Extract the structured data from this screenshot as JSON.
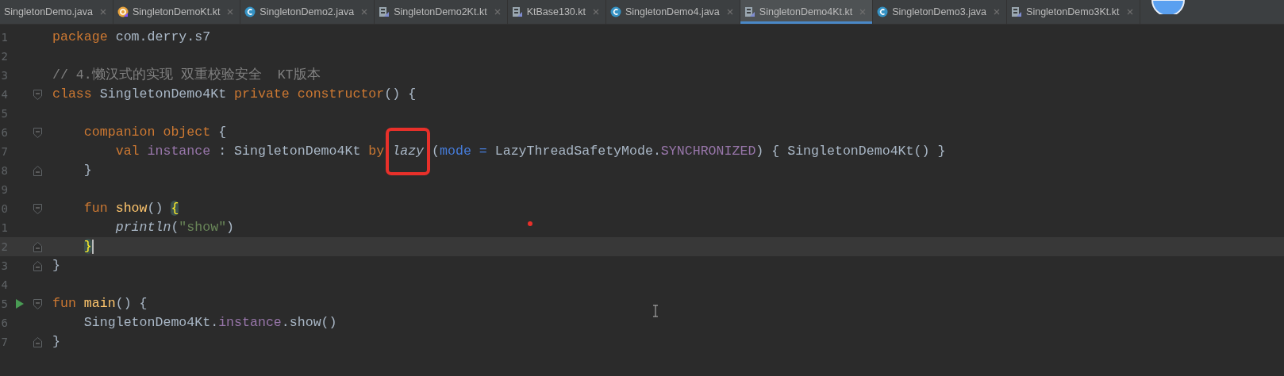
{
  "tabs": [
    {
      "label": "SingletonDemo.java",
      "kind": "plain",
      "selected": false
    },
    {
      "label": "SingletonDemoKt.kt",
      "kind": "kotlin-object",
      "selected": false
    },
    {
      "label": "SingletonDemo2.java",
      "kind": "java",
      "selected": false
    },
    {
      "label": "SingletonDemo2Kt.kt",
      "kind": "kotlin-file",
      "selected": false
    },
    {
      "label": "KtBase130.kt",
      "kind": "kotlin-file",
      "selected": false
    },
    {
      "label": "SingletonDemo4.java",
      "kind": "java",
      "selected": false
    },
    {
      "label": "SingletonDemo4Kt.kt",
      "kind": "kotlin-file",
      "selected": true
    },
    {
      "label": "SingletonDemo3.java",
      "kind": "java",
      "selected": false
    },
    {
      "label": "SingletonDemo3Kt.kt",
      "kind": "kotlin-file",
      "selected": false
    }
  ],
  "editor": {
    "lines": [
      {
        "number": "1",
        "kind": "plain",
        "current": false,
        "run": false,
        "tokens": [
          {
            "kind": "kw",
            "text": "package"
          },
          {
            "kind": "plain",
            "text": " com.derry.s7"
          }
        ]
      },
      {
        "number": "2",
        "kind": "plain",
        "current": false,
        "run": false
      },
      {
        "number": "3",
        "kind": "plain",
        "current": false,
        "run": false,
        "tokens": [
          {
            "kind": "comment",
            "text": "// 4.懒汉式的实现 双重校验安全  KT版本"
          }
        ]
      },
      {
        "number": "4",
        "kind": "fold-start",
        "current": false,
        "run": false,
        "tokens": [
          {
            "kind": "kw",
            "text": "class"
          },
          {
            "kind": "plain",
            "text": " SingletonDemo4Kt "
          },
          {
            "kind": "kw",
            "text": "private constructor"
          },
          {
            "kind": "plain",
            "text": "() {"
          }
        ]
      },
      {
        "number": "5",
        "kind": "plain",
        "current": false,
        "run": false
      },
      {
        "number": "6",
        "kind": "fold-start",
        "current": false,
        "run": false,
        "tokens": [
          {
            "kind": "kw",
            "text": "    companion object"
          },
          {
            "kind": "plain",
            "text": " {"
          }
        ]
      },
      {
        "number": "7",
        "kind": "plain",
        "current": false,
        "run": false,
        "tokens": [
          {
            "kind": "kw",
            "text": "        val "
          },
          {
            "kind": "prop",
            "text": "instance"
          },
          {
            "kind": "plain",
            "text": " : SingletonDemo4Kt "
          },
          {
            "kind": "kw",
            "text": "by "
          },
          {
            "kind": "call",
            "text": "lazy",
            "boxed": true
          },
          {
            "kind": "plain",
            "text": " ("
          },
          {
            "kind": "arg",
            "text": "mode = "
          },
          {
            "kind": "plain",
            "text": "LazyThreadSafetyMode."
          },
          {
            "kind": "prop",
            "text": "SYNCHRONIZED"
          },
          {
            "kind": "plain",
            "text": ") { SingletonDemo4Kt() }"
          }
        ]
      },
      {
        "number": "8",
        "kind": "fold-end",
        "current": false,
        "run": false,
        "tokens": [
          {
            "kind": "plain",
            "text": "    }"
          }
        ]
      },
      {
        "number": "9",
        "kind": "plain",
        "current": false,
        "run": false
      },
      {
        "number": "0",
        "kind": "fold-start",
        "current": false,
        "run": false,
        "tokens": [
          {
            "kind": "kw",
            "text": "    fun "
          },
          {
            "kind": "decl",
            "text": "show"
          },
          {
            "kind": "plain",
            "text": "() "
          },
          {
            "kind": "brace",
            "text": "{"
          }
        ]
      },
      {
        "number": "1",
        "kind": "plain",
        "current": false,
        "run": false,
        "tokens": [
          {
            "kind": "call",
            "text": "        println"
          },
          {
            "kind": "plain",
            "text": "("
          },
          {
            "kind": "str",
            "text": "\"show\""
          },
          {
            "kind": "plain",
            "text": ")"
          }
        ]
      },
      {
        "number": "2",
        "kind": "fold-end",
        "current": true,
        "run": false,
        "tokens": [
          {
            "kind": "brace",
            "text": "    }"
          }
        ]
      },
      {
        "number": "3",
        "kind": "fold-end",
        "current": false,
        "run": false,
        "tokens": [
          {
            "kind": "plain",
            "text": "}"
          }
        ]
      },
      {
        "number": "4",
        "kind": "plain",
        "current": false,
        "run": false
      },
      {
        "number": "5",
        "kind": "fold-start",
        "current": false,
        "run": true,
        "tokens": [
          {
            "kind": "kw",
            "text": "fun "
          },
          {
            "kind": "decl",
            "text": "main"
          },
          {
            "kind": "plain",
            "text": "() {"
          }
        ]
      },
      {
        "number": "6",
        "kind": "plain",
        "current": false,
        "run": false,
        "tokens": [
          {
            "kind": "plain",
            "text": "    SingletonDemo4Kt."
          },
          {
            "kind": "prop",
            "text": "instance"
          },
          {
            "kind": "plain",
            "text": ".show()"
          }
        ]
      },
      {
        "number": "7",
        "kind": "fold-end",
        "current": false,
        "run": false,
        "tokens": [
          {
            "kind": "plain",
            "text": "}"
          }
        ]
      }
    ]
  }
}
